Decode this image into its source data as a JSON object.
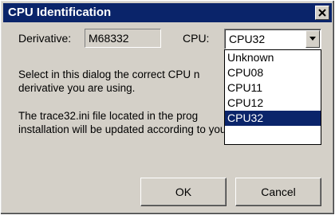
{
  "window": {
    "title": "CPU Identification",
    "close_icon": "close-icon"
  },
  "form": {
    "derivative_label": "Derivative:",
    "derivative_value": "M68332",
    "cpu_label": "CPU:",
    "cpu_value": "CPU32"
  },
  "description": {
    "line1": "Select in this dialog the correct CPU n",
    "line2": "derivative you are using.",
    "line3": "The trace32.ini file located in the prog",
    "line4": "installation will be updated according to your selection."
  },
  "dropdown": {
    "options": [
      "Unknown",
      "CPU08",
      "CPU11",
      "CPU12",
      "CPU32"
    ],
    "selected": "CPU32"
  },
  "buttons": {
    "ok": "OK",
    "cancel": "Cancel"
  },
  "colors": {
    "titlebar": "#0a246a",
    "dialog_face": "#d4d0c8",
    "selection": "#0a246a"
  }
}
